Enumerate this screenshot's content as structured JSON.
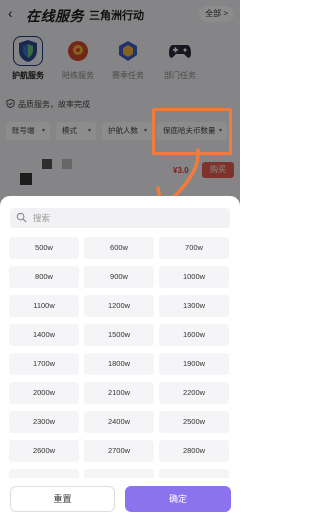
{
  "header": {
    "back_icon": "chevron-left-icon",
    "brand": "在线服务",
    "game": "三角洲行动",
    "all_label": "全部 >"
  },
  "services": [
    {
      "label": "护航服务",
      "icon": "shield-icon",
      "active": true
    },
    {
      "label": "陪练服务",
      "icon": "mascot-icon",
      "active": false
    },
    {
      "label": "赛季任务",
      "icon": "crest-icon",
      "active": false
    },
    {
      "label": "部门任务",
      "icon": "gamepad-icon",
      "active": false
    }
  ],
  "assurance": "品质服务，故率完成",
  "filters": [
    {
      "label": "账号端"
    },
    {
      "label": "模式"
    },
    {
      "label": "护航人数"
    },
    {
      "label": "保底哈夫币数量"
    }
  ],
  "listing": {
    "price": "¥3.0",
    "buy_label": "购买"
  },
  "sheet": {
    "search_placeholder": "搜索",
    "options": [
      "500w",
      "600w",
      "700w",
      "800w",
      "900w",
      "1000w",
      "1100w",
      "1200w",
      "1300w",
      "1400w",
      "1500w",
      "1600w",
      "1700w",
      "1800w",
      "1900w",
      "2000w",
      "2100w",
      "2200w",
      "2300w",
      "2400w",
      "2500w",
      "2600w",
      "2700w",
      "2800w"
    ],
    "reset_label": "重置",
    "confirm_label": "确定"
  },
  "colors": {
    "accent": "#8b73ee",
    "annotation": "#f47a3c",
    "price": "#e0372c"
  }
}
